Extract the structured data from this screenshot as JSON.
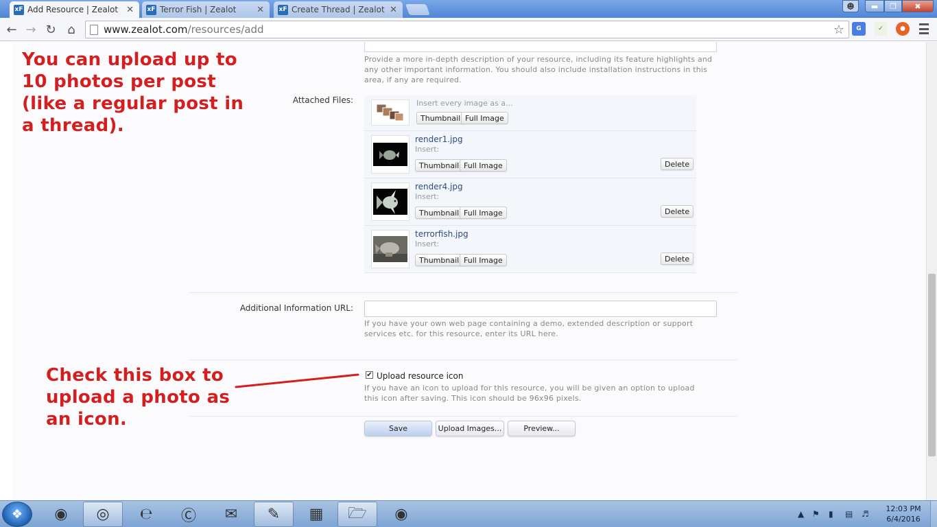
{
  "browser": {
    "tabs": [
      {
        "favicon": "xF",
        "title": "Add Resource | Zealot",
        "active": true
      },
      {
        "favicon": "xF",
        "title": "Terror Fish | Zealot",
        "active": false
      },
      {
        "favicon": "xF",
        "title": "Create Thread | Zealot",
        "active": false
      }
    ],
    "close_glyph": "✕",
    "url_host": "www.zealot.com",
    "url_path": "/resources/add",
    "star_glyph": "☆"
  },
  "form": {
    "description_hint": "Provide a more in-depth description of your resource, including its feature highlights and any other important information. You should also include installation instructions in this area, if any are required.",
    "attached_label": "Attached Files:",
    "insert_every": "Insert every image as a...",
    "thumbnail_label": "Thumbnail",
    "full_image_label": "Full Image",
    "delete_label": "Delete",
    "insert_label": "Insert:",
    "attachments": [
      {
        "name": "render1.jpg"
      },
      {
        "name": "render4.jpg"
      },
      {
        "name": "terrorfish.jpg"
      }
    ],
    "url_label": "Additional Information URL:",
    "url_value": "",
    "url_hint": "If you have your own web page containing a demo, extended description or support services etc. for this resource, enter its URL here.",
    "icon_checkbox_label": "Upload resource icon",
    "icon_checked": true,
    "icon_hint": "If you have an icon to upload for this resource, you will be given an option to upload this icon after saving. This icon should be 96x96 pixels.",
    "save_label": "Save",
    "upload_label": "Upload Images...",
    "preview_label": "Preview..."
  },
  "annotations": {
    "top": "You can upload up to 10 photos per post (like a regular post in a thread).",
    "bottom": "Check this box to upload a photo as an icon.",
    "color": "#d41f1f"
  },
  "taskbar": {
    "time": "12:03 PM",
    "date": "6/4/2016"
  }
}
